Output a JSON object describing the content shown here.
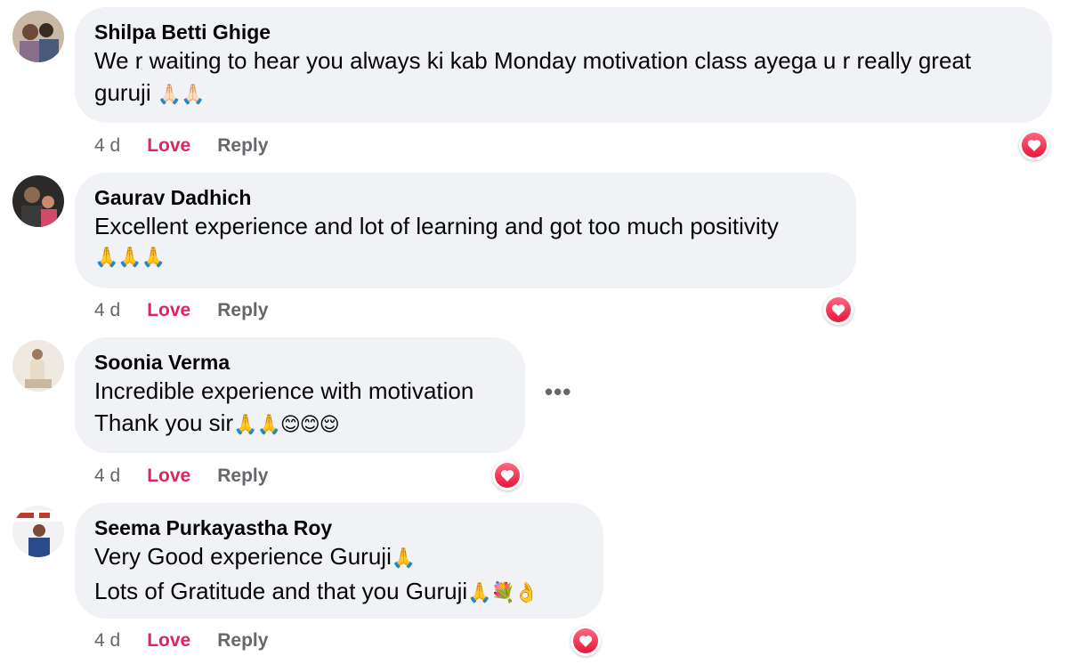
{
  "comments": [
    {
      "author": "Shilpa Betti Ghige",
      "text": "We r waiting to hear you always ki kab Monday motivation class ayega u r really great guruji",
      "emoji": "🙏🏻🙏🏻",
      "time": "4 d",
      "love": "Love",
      "reply": "Reply"
    },
    {
      "author": "Gaurav Dadhich",
      "text": "Excellent experience and lot of learning and got too much positivity",
      "emoji": "🙏🙏🙏",
      "time": "4 d",
      "love": "Love",
      "reply": "Reply"
    },
    {
      "author": "Soonia Verma",
      "line1": "Incredible experience with motivation",
      "line2": "Thank you sir",
      "emoji": "🙏🙏😊😊😌",
      "time": "4 d",
      "love": "Love",
      "reply": "Reply",
      "more": "•••"
    },
    {
      "author": "Seema Purkayastha Roy",
      "line1": "Very Good experience Guruji",
      "emoji1": "🙏",
      "line2": "Lots of Gratitude and that you Guruji",
      "emoji2": "🙏💐👌",
      "time": "4 d",
      "love": "Love",
      "reply": "Reply"
    }
  ],
  "reaction_icon": "heart-icon",
  "colors": {
    "bubble": "#f0f2f5",
    "love": "#e0245e",
    "meta": "#65676b",
    "heart": "#f02849"
  }
}
